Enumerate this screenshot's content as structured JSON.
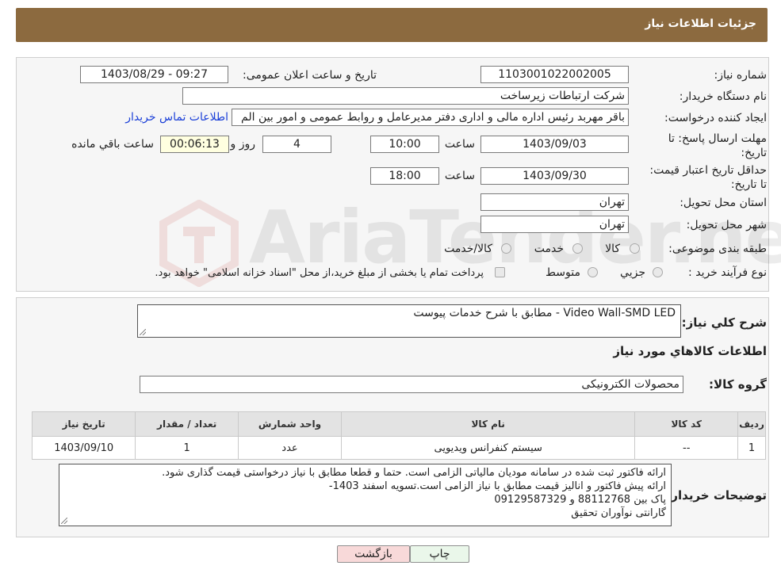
{
  "header": {
    "title": "جزئیات اطلاعات نیاز"
  },
  "watermark": {
    "text": "AriaTender.neT"
  },
  "fields": {
    "need_number": {
      "label": "شماره نیاز:",
      "value": "1103001022002005"
    },
    "announce_datetime": {
      "label": "تاریخ و ساعت اعلان عمومی:",
      "value": "1403/08/29 - 09:27"
    },
    "buyer_org": {
      "label": "نام دستگاه خریدار:",
      "value": "شرکت ارتباطات زیرساخت"
    },
    "requester": {
      "label": "ایجاد کننده درخواست:",
      "value": "باقر مهربد رئیس اداره مالی و اداری دفتر مدیرعامل و روابط عمومی و امور بین الم",
      "contact_link": "اطلاعات تماس خریدار"
    },
    "reply_deadline": {
      "label": "مهلت ارسال پاسخ: تا تاریخ:",
      "date": "1403/09/03",
      "time_label": "ساعت",
      "time": "10:00",
      "days": "4",
      "days_label": "روز و",
      "remaining": "00:06:13",
      "remaining_label": "ساعت باقي مانده"
    },
    "price_validity": {
      "label": "حداقل تاریخ اعتبار قیمت: تا تاریخ:",
      "date": "1403/09/30",
      "time_label": "ساعت",
      "time": "18:00"
    },
    "province": {
      "label": "استان محل تحویل:",
      "value": "تهران"
    },
    "city": {
      "label": "شهر محل تحویل:",
      "value": "تهران"
    },
    "category": {
      "label": "طبقه بندی موضوعی:",
      "options": [
        "کالا",
        "خدمت",
        "کالا/خدمت"
      ]
    },
    "purchase_type": {
      "label": "نوع فرآیند خرید :",
      "options": [
        "جزيي",
        "متوسط"
      ],
      "note": "پرداخت تمام یا بخشی از مبلغ خرید،از محل \"اسناد خزانه اسلامی\" خواهد بود."
    }
  },
  "description": {
    "label": "شرح کلي نياز:",
    "value": "Video Wall-SMD LED -  مطابق با شرح خدمات پیوست"
  },
  "goods_section": {
    "title": "اطلاعات كالاهاي مورد نياز"
  },
  "goods_group": {
    "label": "گروه كالا:",
    "value": "محصولات الکترونیکی"
  },
  "table": {
    "headers": [
      "رديف",
      "کد کالا",
      "نام کالا",
      "واحد شمارش",
      "تعداد / مقدار",
      "تاریخ نیاز"
    ],
    "rows": [
      [
        "1",
        "--",
        "سیستم کنفرانس ویدیویی",
        "عدد",
        "1",
        "1403/09/10"
      ]
    ]
  },
  "buyer_notes": {
    "label": "توضیحات خریدار:",
    "lines": [
      "ارائه فاکتور ثبت شده در سامانه مودیان مالیاتی الزامی است. حتما و قطعا مطابق با نیاز درخواستی قیمت گذاری شود.",
      "ارائه پیش فاکتور و انالیز قیمت مطابق با نیاز الزامی است.تسویه اسفند 1403-",
      "پاک بین 88112768 و 09129587329",
      "گارانتی نوآوران تحقیق"
    ]
  },
  "buttons": {
    "print": "چاپ",
    "back": "بازگشت"
  },
  "colors": {
    "header": "#8c6a3f",
    "link": "#1a3fd8",
    "back_button": "#f8d9d9",
    "print_button": "#eaf7ea",
    "remaining_box": "#ffffe0"
  }
}
